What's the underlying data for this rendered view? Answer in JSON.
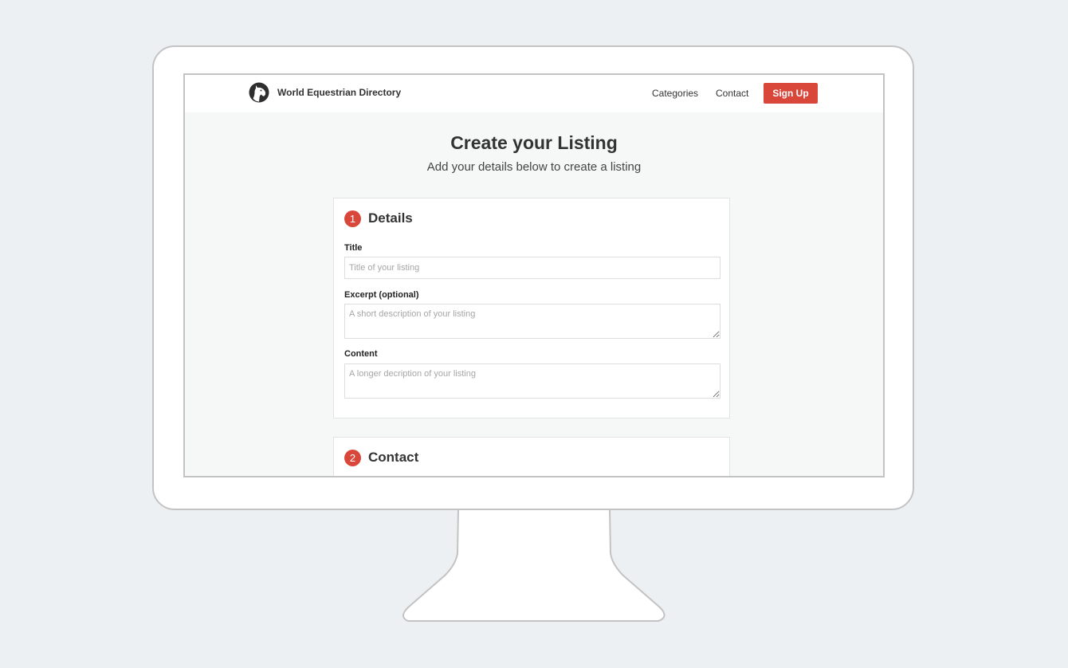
{
  "navbar": {
    "brand": "World Equestrian Directory",
    "logo_icon": "horse-head-icon",
    "links": [
      {
        "label": "Categories"
      },
      {
        "label": "Contact"
      }
    ],
    "signup_label": "Sign Up"
  },
  "page": {
    "title": "Create your Listing",
    "subtitle": "Add your details below to create a listing"
  },
  "sections": [
    {
      "step": "1",
      "heading": "Details",
      "fields": [
        {
          "label": "Title",
          "placeholder": "Title of your listing",
          "value": ""
        },
        {
          "label": "Excerpt (optional)",
          "placeholder": "A short description of your listing",
          "value": ""
        },
        {
          "label": "Content",
          "placeholder": "A longer decription of your listing",
          "value": ""
        }
      ]
    },
    {
      "step": "2",
      "heading": "Contact"
    }
  ],
  "colors": {
    "accent": "#d9473a",
    "page_background": "#edf0f3",
    "screen_background": "#f6f7f7",
    "text": "#333333"
  }
}
